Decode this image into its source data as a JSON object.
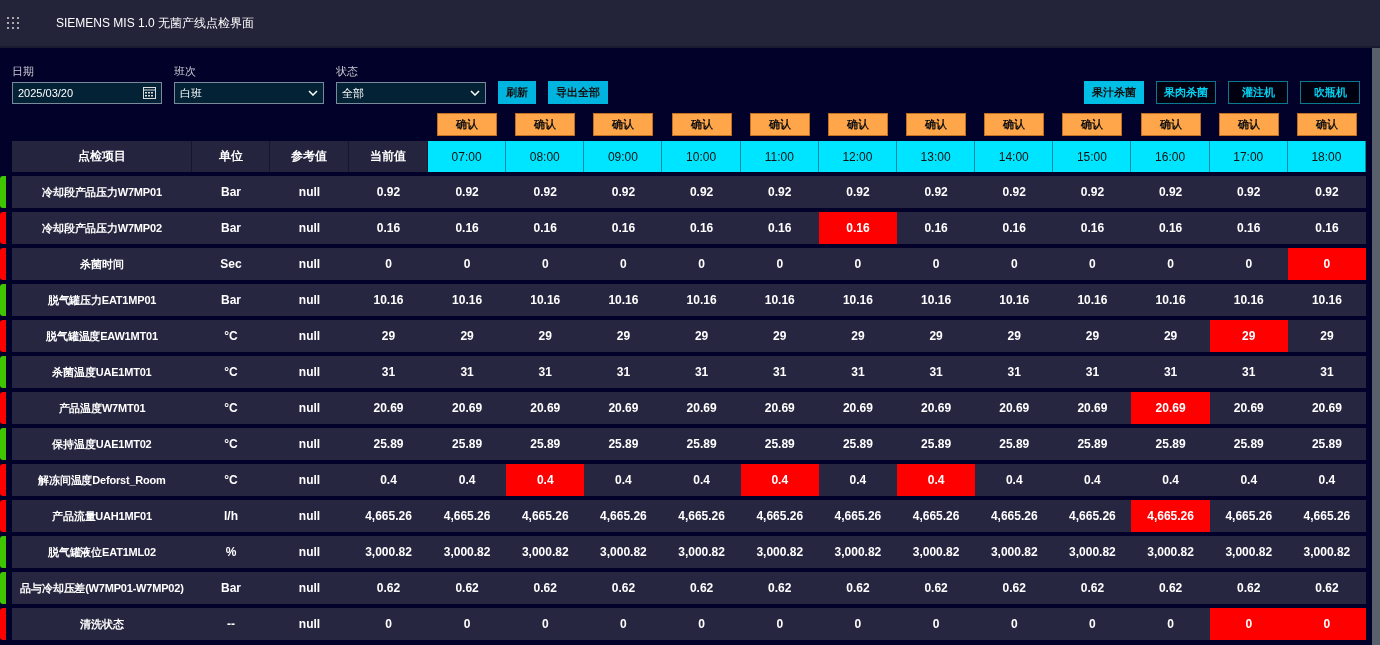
{
  "header": {
    "title": "SIEMENS MIS 1.0 无菌产线点检界面"
  },
  "filters": [
    {
      "kind": "date",
      "label": "日期",
      "value": "2025/03/20"
    },
    {
      "kind": "select",
      "label": "班次",
      "value": "白班"
    },
    {
      "kind": "select",
      "label": "状态",
      "value": "全部"
    }
  ],
  "actions": [
    "刷新",
    "导出全部"
  ],
  "lines": [
    {
      "label": "果汁杀菌",
      "selected": true
    },
    {
      "label": "果肉杀菌",
      "selected": false
    },
    {
      "label": "灌注机",
      "selected": false
    },
    {
      "label": "吹瓶机",
      "selected": false
    }
  ],
  "confirm_labels": [
    "确认",
    "确认",
    "确认",
    "确认",
    "确认",
    "确认",
    "确认",
    "确认",
    "确认",
    "确认",
    "确认",
    "确认"
  ],
  "columns": [
    "点检项目",
    "单位",
    "参考值",
    "当前值"
  ],
  "hours": [
    "07:00",
    "08:00",
    "09:00",
    "10:00",
    "11:00",
    "12:00",
    "13:00",
    "14:00",
    "15:00",
    "16:00",
    "17:00",
    "18:00"
  ],
  "rows": [
    {
      "name": "冷却段产品压力W7MP01",
      "unit": "Bar",
      "ref": "null",
      "current": "0.92",
      "color": "#3fc600",
      "cells": [
        {
          "v": "0.92",
          "alarm": false
        },
        {
          "v": "0.92",
          "alarm": false
        },
        {
          "v": "0.92",
          "alarm": false
        },
        {
          "v": "0.92",
          "alarm": false
        },
        {
          "v": "0.92",
          "alarm": false
        },
        {
          "v": "0.92",
          "alarm": false
        },
        {
          "v": "0.92",
          "alarm": false
        },
        {
          "v": "0.92",
          "alarm": false
        },
        {
          "v": "0.92",
          "alarm": false
        },
        {
          "v": "0.92",
          "alarm": false
        },
        {
          "v": "0.92",
          "alarm": false
        },
        {
          "v": "0.92",
          "alarm": false
        }
      ]
    },
    {
      "name": "冷却段产品压力W7MP02",
      "unit": "Bar",
      "ref": "null",
      "current": "0.16",
      "color": "#ff0000",
      "cells": [
        {
          "v": "0.16",
          "alarm": false
        },
        {
          "v": "0.16",
          "alarm": false
        },
        {
          "v": "0.16",
          "alarm": false
        },
        {
          "v": "0.16",
          "alarm": false
        },
        {
          "v": "0.16",
          "alarm": false
        },
        {
          "v": "0.16",
          "alarm": true
        },
        {
          "v": "0.16",
          "alarm": false
        },
        {
          "v": "0.16",
          "alarm": false
        },
        {
          "v": "0.16",
          "alarm": false
        },
        {
          "v": "0.16",
          "alarm": false
        },
        {
          "v": "0.16",
          "alarm": false
        },
        {
          "v": "0.16",
          "alarm": false
        }
      ]
    },
    {
      "name": "杀菌时间",
      "unit": "Sec",
      "ref": "null",
      "current": "0",
      "color": "#ff0000",
      "cells": [
        {
          "v": "0",
          "alarm": false
        },
        {
          "v": "0",
          "alarm": false
        },
        {
          "v": "0",
          "alarm": false
        },
        {
          "v": "0",
          "alarm": false
        },
        {
          "v": "0",
          "alarm": false
        },
        {
          "v": "0",
          "alarm": false
        },
        {
          "v": "0",
          "alarm": false
        },
        {
          "v": "0",
          "alarm": false
        },
        {
          "v": "0",
          "alarm": false
        },
        {
          "v": "0",
          "alarm": false
        },
        {
          "v": "0",
          "alarm": false
        },
        {
          "v": "0",
          "alarm": true
        }
      ]
    },
    {
      "name": "脱气罐压力EAT1MP01",
      "unit": "Bar",
      "ref": "null",
      "current": "10.16",
      "color": "#3fc600",
      "cells": [
        {
          "v": "10.16",
          "alarm": false
        },
        {
          "v": "10.16",
          "alarm": false
        },
        {
          "v": "10.16",
          "alarm": false
        },
        {
          "v": "10.16",
          "alarm": false
        },
        {
          "v": "10.16",
          "alarm": false
        },
        {
          "v": "10.16",
          "alarm": false
        },
        {
          "v": "10.16",
          "alarm": false
        },
        {
          "v": "10.16",
          "alarm": false
        },
        {
          "v": "10.16",
          "alarm": false
        },
        {
          "v": "10.16",
          "alarm": false
        },
        {
          "v": "10.16",
          "alarm": false
        },
        {
          "v": "10.16",
          "alarm": false
        }
      ]
    },
    {
      "name": "脱气罐温度EAW1MT01",
      "unit": "°C",
      "ref": "null",
      "current": "29",
      "color": "#ff0000",
      "cells": [
        {
          "v": "29",
          "alarm": false
        },
        {
          "v": "29",
          "alarm": false
        },
        {
          "v": "29",
          "alarm": false
        },
        {
          "v": "29",
          "alarm": false
        },
        {
          "v": "29",
          "alarm": false
        },
        {
          "v": "29",
          "alarm": false
        },
        {
          "v": "29",
          "alarm": false
        },
        {
          "v": "29",
          "alarm": false
        },
        {
          "v": "29",
          "alarm": false
        },
        {
          "v": "29",
          "alarm": false
        },
        {
          "v": "29",
          "alarm": true
        },
        {
          "v": "29",
          "alarm": false
        }
      ]
    },
    {
      "name": "杀菌温度UAE1MT01",
      "unit": "°C",
      "ref": "null",
      "current": "31",
      "color": "#3fc600",
      "cells": [
        {
          "v": "31",
          "alarm": false
        },
        {
          "v": "31",
          "alarm": false
        },
        {
          "v": "31",
          "alarm": false
        },
        {
          "v": "31",
          "alarm": false
        },
        {
          "v": "31",
          "alarm": false
        },
        {
          "v": "31",
          "alarm": false
        },
        {
          "v": "31",
          "alarm": false
        },
        {
          "v": "31",
          "alarm": false
        },
        {
          "v": "31",
          "alarm": false
        },
        {
          "v": "31",
          "alarm": false
        },
        {
          "v": "31",
          "alarm": false
        },
        {
          "v": "31",
          "alarm": false
        }
      ]
    },
    {
      "name": "产品温度W7MT01",
      "unit": "°C",
      "ref": "null",
      "current": "20.69",
      "color": "#ff0000",
      "cells": [
        {
          "v": "20.69",
          "alarm": false
        },
        {
          "v": "20.69",
          "alarm": false
        },
        {
          "v": "20.69",
          "alarm": false
        },
        {
          "v": "20.69",
          "alarm": false
        },
        {
          "v": "20.69",
          "alarm": false
        },
        {
          "v": "20.69",
          "alarm": false
        },
        {
          "v": "20.69",
          "alarm": false
        },
        {
          "v": "20.69",
          "alarm": false
        },
        {
          "v": "20.69",
          "alarm": false
        },
        {
          "v": "20.69",
          "alarm": true
        },
        {
          "v": "20.69",
          "alarm": false
        },
        {
          "v": "20.69",
          "alarm": false
        }
      ]
    },
    {
      "name": "保持温度UAE1MT02",
      "unit": "°C",
      "ref": "null",
      "current": "25.89",
      "color": "#3fc600",
      "cells": [
        {
          "v": "25.89",
          "alarm": false
        },
        {
          "v": "25.89",
          "alarm": false
        },
        {
          "v": "25.89",
          "alarm": false
        },
        {
          "v": "25.89",
          "alarm": false
        },
        {
          "v": "25.89",
          "alarm": false
        },
        {
          "v": "25.89",
          "alarm": false
        },
        {
          "v": "25.89",
          "alarm": false
        },
        {
          "v": "25.89",
          "alarm": false
        },
        {
          "v": "25.89",
          "alarm": false
        },
        {
          "v": "25.89",
          "alarm": false
        },
        {
          "v": "25.89",
          "alarm": false
        },
        {
          "v": "25.89",
          "alarm": false
        }
      ]
    },
    {
      "name": "解冻间温度Deforst_Room",
      "unit": "°C",
      "ref": "null",
      "current": "0.4",
      "color": "#ff0000",
      "cells": [
        {
          "v": "0.4",
          "alarm": false
        },
        {
          "v": "0.4",
          "alarm": true
        },
        {
          "v": "0.4",
          "alarm": false
        },
        {
          "v": "0.4",
          "alarm": false
        },
        {
          "v": "0.4",
          "alarm": true
        },
        {
          "v": "0.4",
          "alarm": false
        },
        {
          "v": "0.4",
          "alarm": true
        },
        {
          "v": "0.4",
          "alarm": false
        },
        {
          "v": "0.4",
          "alarm": false
        },
        {
          "v": "0.4",
          "alarm": false
        },
        {
          "v": "0.4",
          "alarm": false
        },
        {
          "v": "0.4",
          "alarm": false
        }
      ]
    },
    {
      "name": "产品流量UAH1MF01",
      "unit": "l/h",
      "ref": "null",
      "current": "4,665.26",
      "color": "#ff0000",
      "cells": [
        {
          "v": "4,665.26",
          "alarm": false
        },
        {
          "v": "4,665.26",
          "alarm": false
        },
        {
          "v": "4,665.26",
          "alarm": false
        },
        {
          "v": "4,665.26",
          "alarm": false
        },
        {
          "v": "4,665.26",
          "alarm": false
        },
        {
          "v": "4,665.26",
          "alarm": false
        },
        {
          "v": "4,665.26",
          "alarm": false
        },
        {
          "v": "4,665.26",
          "alarm": false
        },
        {
          "v": "4,665.26",
          "alarm": false
        },
        {
          "v": "4,665.26",
          "alarm": true
        },
        {
          "v": "4,665.26",
          "alarm": false
        },
        {
          "v": "4,665.26",
          "alarm": false
        }
      ]
    },
    {
      "name": "脱气罐液位EAT1ML02",
      "unit": "%",
      "ref": "null",
      "current": "3,000.82",
      "color": "#3fc600",
      "cells": [
        {
          "v": "3,000.82",
          "alarm": false
        },
        {
          "v": "3,000.82",
          "alarm": false
        },
        {
          "v": "3,000.82",
          "alarm": false
        },
        {
          "v": "3,000.82",
          "alarm": false
        },
        {
          "v": "3,000.82",
          "alarm": false
        },
        {
          "v": "3,000.82",
          "alarm": false
        },
        {
          "v": "3,000.82",
          "alarm": false
        },
        {
          "v": "3,000.82",
          "alarm": false
        },
        {
          "v": "3,000.82",
          "alarm": false
        },
        {
          "v": "3,000.82",
          "alarm": false
        },
        {
          "v": "3,000.82",
          "alarm": false
        },
        {
          "v": "3,000.82",
          "alarm": false
        }
      ]
    },
    {
      "name": "品与冷却压差(W7MP01-W7MP02)",
      "unit": "Bar",
      "ref": "null",
      "current": "0.62",
      "color": "#3fc600",
      "cells": [
        {
          "v": "0.62",
          "alarm": false
        },
        {
          "v": "0.62",
          "alarm": false
        },
        {
          "v": "0.62",
          "alarm": false
        },
        {
          "v": "0.62",
          "alarm": false
        },
        {
          "v": "0.62",
          "alarm": false
        },
        {
          "v": "0.62",
          "alarm": false
        },
        {
          "v": "0.62",
          "alarm": false
        },
        {
          "v": "0.62",
          "alarm": false
        },
        {
          "v": "0.62",
          "alarm": false
        },
        {
          "v": "0.62",
          "alarm": false
        },
        {
          "v": "0.62",
          "alarm": false
        },
        {
          "v": "0.62",
          "alarm": false
        }
      ]
    },
    {
      "name": "清洗状态",
      "unit": "--",
      "ref": "null",
      "current": "0",
      "color": "#ff0000",
      "cells": [
        {
          "v": "0",
          "alarm": false
        },
        {
          "v": "0",
          "alarm": false
        },
        {
          "v": "0",
          "alarm": false
        },
        {
          "v": "0",
          "alarm": false
        },
        {
          "v": "0",
          "alarm": false
        },
        {
          "v": "0",
          "alarm": false
        },
        {
          "v": "0",
          "alarm": false
        },
        {
          "v": "0",
          "alarm": false
        },
        {
          "v": "0",
          "alarm": false
        },
        {
          "v": "0",
          "alarm": false
        },
        {
          "v": "0",
          "alarm": true
        },
        {
          "v": "0",
          "alarm": true
        }
      ]
    }
  ]
}
